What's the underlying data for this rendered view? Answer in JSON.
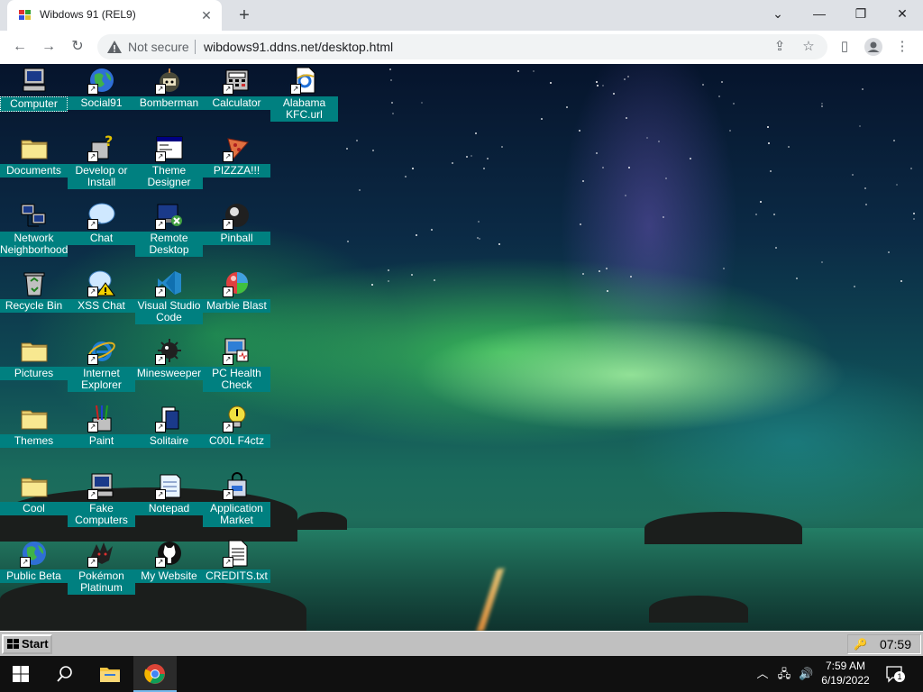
{
  "browser": {
    "tab_title": "Wibdows 91 (REL9)",
    "not_secure": "Not secure",
    "url": "wibdows91.ddns.net/desktop.html"
  },
  "desktop": {
    "icons": [
      {
        "label": "Computer",
        "icon": "computer-icon"
      },
      {
        "label": "Social91",
        "icon": "globe-icon"
      },
      {
        "label": "Bomberman",
        "icon": "bomberman-icon"
      },
      {
        "label": "Calculator",
        "icon": "calculator-icon"
      },
      {
        "label": "Alabama KFC.url",
        "icon": "ie-url-icon"
      },
      {
        "label": "Documents",
        "icon": "folder-icon"
      },
      {
        "label": "Develop or Install",
        "icon": "help-icon"
      },
      {
        "label": "Theme Designer",
        "icon": "window-icon"
      },
      {
        "label": "PIZZZA!!!",
        "icon": "pizza-icon"
      },
      {
        "label": "Network Neighborhood",
        "icon": "network-icon"
      },
      {
        "label": "Chat",
        "icon": "chat-icon"
      },
      {
        "label": "Remote Desktop",
        "icon": "remote-desktop-icon"
      },
      {
        "label": "Pinball",
        "icon": "pinball-icon"
      },
      {
        "label": "Recycle Bin",
        "icon": "recycle-bin-icon"
      },
      {
        "label": "XSS Chat",
        "icon": "xss-chat-icon"
      },
      {
        "label": "Visual Studio Code",
        "icon": "vscode-icon"
      },
      {
        "label": "Marble Blast",
        "icon": "marble-icon"
      },
      {
        "label": "Pictures",
        "icon": "folder-icon"
      },
      {
        "label": "Internet Explorer",
        "icon": "ie-icon"
      },
      {
        "label": "Minesweeper",
        "icon": "mine-icon"
      },
      {
        "label": "PC Health Check",
        "icon": "health-check-icon"
      },
      {
        "label": "Themes",
        "icon": "folder-icon"
      },
      {
        "label": "Paint",
        "icon": "paint-icon"
      },
      {
        "label": "Solitaire",
        "icon": "cards-icon"
      },
      {
        "label": "C00L F4ctz",
        "icon": "lightbulb-icon"
      },
      {
        "label": "Cool",
        "icon": "folder-icon"
      },
      {
        "label": "Fake Computers",
        "icon": "computer-icon"
      },
      {
        "label": "Notepad",
        "icon": "notepad-icon"
      },
      {
        "label": "Application Market",
        "icon": "market-icon"
      },
      {
        "label": "Public Beta",
        "icon": "globe-icon"
      },
      {
        "label": "Pokémon Platinum",
        "icon": "pokemon-icon"
      },
      {
        "label": "My Website",
        "icon": "github-icon"
      },
      {
        "label": "CREDITS.txt",
        "icon": "text-file-icon"
      }
    ]
  },
  "taskbar9x": {
    "start_label": "Start",
    "clock": "07:59"
  },
  "taskbar10": {
    "time": "7:59 AM",
    "date": "6/19/2022",
    "notification_count": "1"
  },
  "colors": {
    "icon_label_bg": "#008080",
    "taskbar9x_bg": "#c0c0c0",
    "taskbar10_bg": "#101010"
  }
}
